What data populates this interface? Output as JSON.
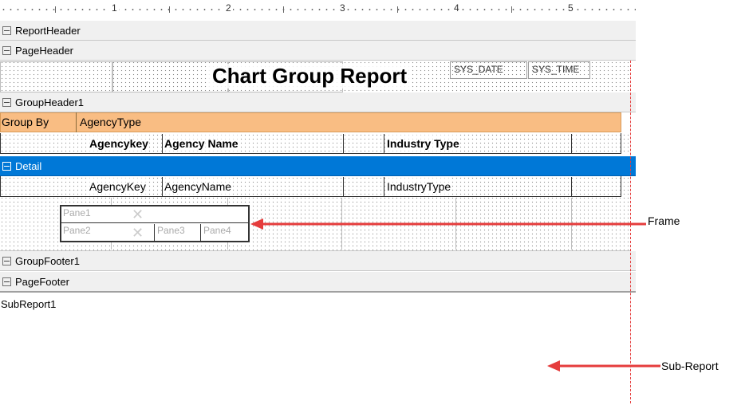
{
  "ruler": {
    "labels": [
      "1",
      "2",
      "3",
      "4",
      "5"
    ]
  },
  "bands": {
    "report_header": "ReportHeader",
    "page_header": "PageHeader",
    "group_header": "GroupHeader1",
    "detail": "Detail",
    "group_footer": "GroupFooter1",
    "page_footer": "PageFooter"
  },
  "page_header": {
    "title": "Chart Group Report",
    "sys_date": "SYS_DATE",
    "sys_time": "SYS_TIME"
  },
  "group_header": {
    "group_by_label": "Group By",
    "group_by_value": "AgencyType",
    "col_agency_key": "Agencykey",
    "col_agency_name": "Agency Name",
    "col_industry_type": "Industry Type"
  },
  "detail": {
    "agency_key": "AgencyKey",
    "agency_name": "AgencyName",
    "industry_type": "IndustryType",
    "frame_panes": [
      "Pane1",
      "Pane2",
      "Pane3",
      "Pane4"
    ]
  },
  "subreport": {
    "label": "SubReport1"
  },
  "callouts": {
    "frame": "Frame",
    "subreport": "Sub-Report"
  },
  "colors": {
    "selected_band": "#0078d7",
    "group_bar": "#f9bd83",
    "arrow": "#e53c3c"
  }
}
